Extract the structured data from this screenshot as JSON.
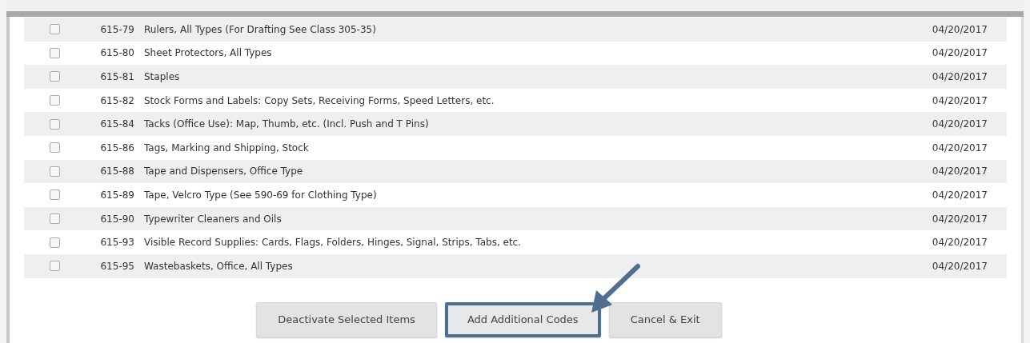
{
  "rows": [
    {
      "checked": false,
      "code": "615-79",
      "description": "Rulers, All Types (For Drafting See Class 305-35)",
      "date": "04/20/2017"
    },
    {
      "checked": false,
      "code": "615-80",
      "description": "Sheet Protectors, All Types",
      "date": "04/20/2017"
    },
    {
      "checked": false,
      "code": "615-81",
      "description": "Staples",
      "date": "04/20/2017"
    },
    {
      "checked": false,
      "code": "615-82",
      "description": "Stock Forms and Labels: Copy Sets, Receiving Forms, Speed Letters, etc.",
      "date": "04/20/2017"
    },
    {
      "checked": false,
      "code": "615-84",
      "description": "Tacks (Office Use): Map, Thumb, etc. (Incl. Push and T Pins)",
      "date": "04/20/2017"
    },
    {
      "checked": false,
      "code": "615-86",
      "description": "Tags, Marking and Shipping, Stock",
      "date": "04/20/2017"
    },
    {
      "checked": false,
      "code": "615-88",
      "description": "Tape and Dispensers, Office Type",
      "date": "04/20/2017"
    },
    {
      "checked": false,
      "code": "615-89",
      "description": "Tape, Velcro Type (See 590-69 for Clothing Type)",
      "date": "04/20/2017"
    },
    {
      "checked": false,
      "code": "615-90",
      "description": "Typewriter Cleaners and Oils",
      "date": "04/20/2017"
    },
    {
      "checked": false,
      "code": "615-93",
      "description": "Visible Record Supplies: Cards, Flags, Folders, Hinges, Signal, Strips, Tabs, etc.",
      "date": "04/20/2017"
    },
    {
      "checked": false,
      "code": "615-95",
      "description": "Wastebaskets, Office, All Types",
      "date": "04/20/2017"
    }
  ],
  "buttons": [
    {
      "label": "Deactivate Selected Items",
      "highlighted": false
    },
    {
      "label": "Add Additional Codes",
      "highlighted": true
    },
    {
      "label": "Cancel & Exit",
      "highlighted": false
    }
  ]
}
